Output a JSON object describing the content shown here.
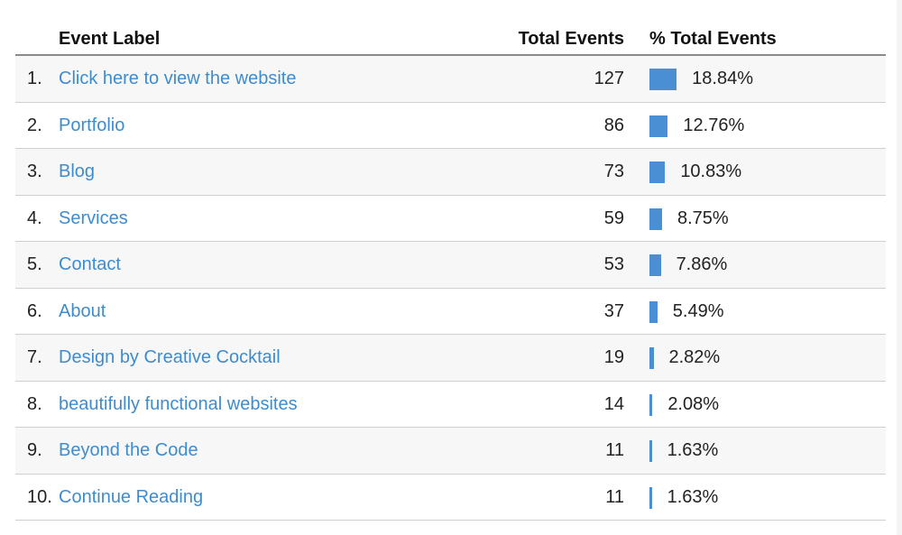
{
  "columns": {
    "label": "Event Label",
    "total": "Total Events",
    "percent": "% Total Events"
  },
  "bar_color": "#4a8fd3",
  "link_color": "#3d8ccf",
  "rows": [
    {
      "rank": "1.",
      "label": "Click here to view the website",
      "total": "127",
      "percent": "18.84%",
      "percent_value": 18.84
    },
    {
      "rank": "2.",
      "label": "Portfolio",
      "total": "86",
      "percent": "12.76%",
      "percent_value": 12.76
    },
    {
      "rank": "3.",
      "label": "Blog",
      "total": "73",
      "percent": "10.83%",
      "percent_value": 10.83
    },
    {
      "rank": "4.",
      "label": "Services",
      "total": "59",
      "percent": "8.75%",
      "percent_value": 8.75
    },
    {
      "rank": "5.",
      "label": "Contact",
      "total": "53",
      "percent": "7.86%",
      "percent_value": 7.86
    },
    {
      "rank": "6.",
      "label": "About",
      "total": "37",
      "percent": "5.49%",
      "percent_value": 5.49
    },
    {
      "rank": "7.",
      "label": "Design by Creative Cocktail",
      "total": "19",
      "percent": "2.82%",
      "percent_value": 2.82
    },
    {
      "rank": "8.",
      "label": "beautifully functional websites",
      "total": "14",
      "percent": "2.08%",
      "percent_value": 2.08
    },
    {
      "rank": "9.",
      "label": "Beyond the Code",
      "total": "11",
      "percent": "1.63%",
      "percent_value": 1.63
    },
    {
      "rank": "10.",
      "label": "Continue Reading",
      "total": "11",
      "percent": "1.63%",
      "percent_value": 1.63
    }
  ]
}
